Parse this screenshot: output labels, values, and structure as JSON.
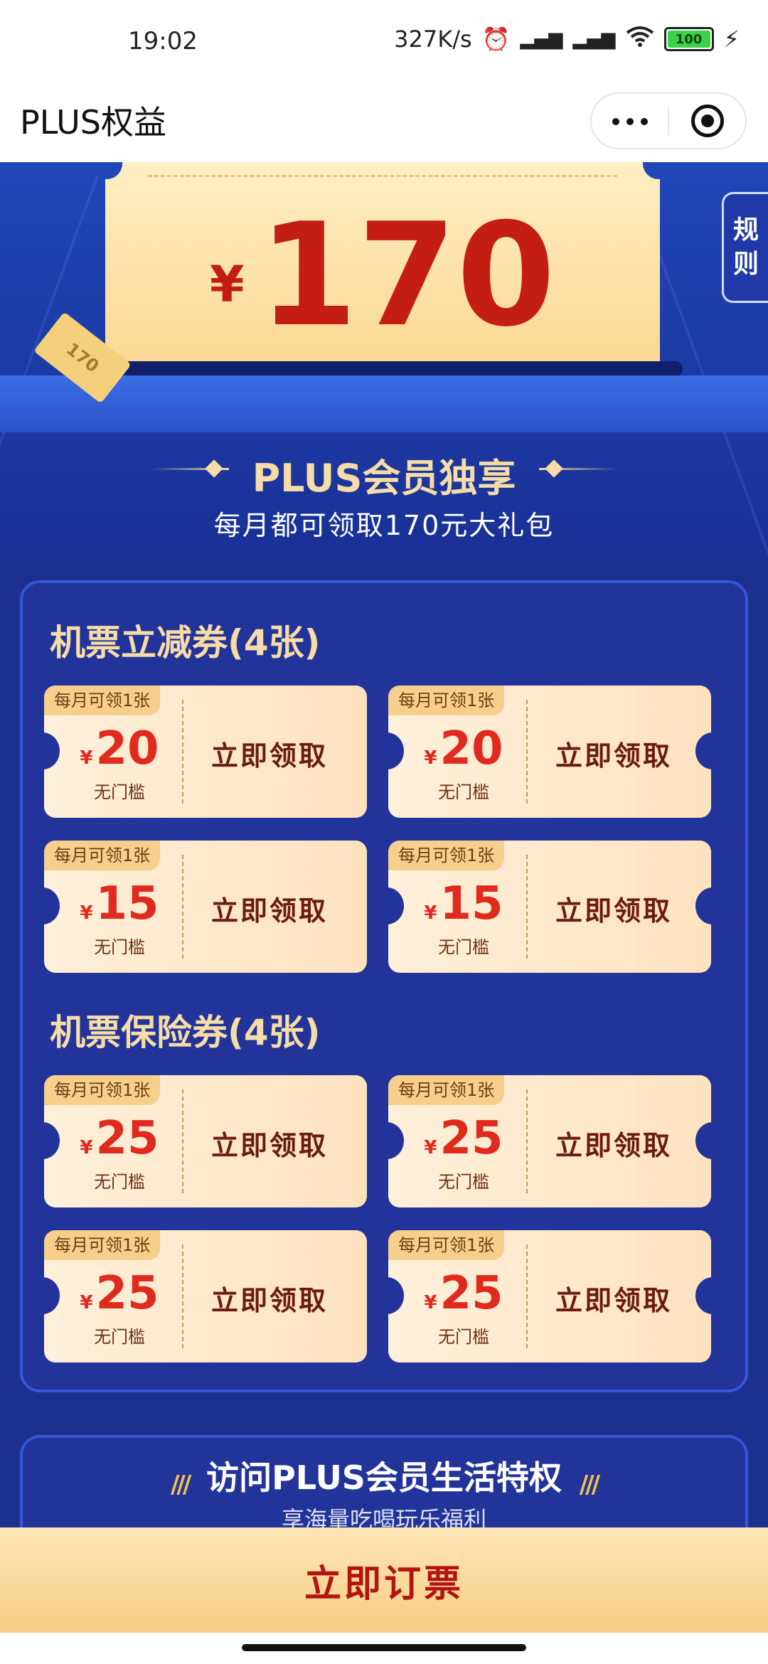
{
  "status_bar": {
    "time": "19:02",
    "speed": "327K/s",
    "battery": "100",
    "icons": [
      "alarm-icon",
      "signal-hd-icon",
      "signal-hd-icon",
      "wifi-icon",
      "battery-icon",
      "charging-icon"
    ]
  },
  "header": {
    "title": "PLUS权益",
    "more_icon": "more-dots-icon",
    "close_icon": "target-circle-icon"
  },
  "hero": {
    "currency": "¥",
    "amount": "170",
    "stub_text": "170",
    "rules_label": "规\n则",
    "plus_title": "PLUS会员独享",
    "plus_subtitle": "每月都可领取170元大礼包"
  },
  "sections": [
    {
      "title": "机票立减券(4张)",
      "coupons": [
        {
          "tag": "每月可领1张",
          "currency": "¥",
          "value": "20",
          "condition": "无门槛",
          "action": "立即领取"
        },
        {
          "tag": "每月可领1张",
          "currency": "¥",
          "value": "20",
          "condition": "无门槛",
          "action": "立即领取"
        },
        {
          "tag": "每月可领1张",
          "currency": "¥",
          "value": "15",
          "condition": "无门槛",
          "action": "立即领取"
        },
        {
          "tag": "每月可领1张",
          "currency": "¥",
          "value": "15",
          "condition": "无门槛",
          "action": "立即领取"
        }
      ]
    },
    {
      "title": "机票保险券(4张)",
      "coupons": [
        {
          "tag": "每月可领1张",
          "currency": "¥",
          "value": "25",
          "condition": "无门槛",
          "action": "立即领取"
        },
        {
          "tag": "每月可领1张",
          "currency": "¥",
          "value": "25",
          "condition": "无门槛",
          "action": "立即领取"
        },
        {
          "tag": "每月可领1张",
          "currency": "¥",
          "value": "25",
          "condition": "无门槛",
          "action": "立即领取"
        },
        {
          "tag": "每月可领1张",
          "currency": "¥",
          "value": "25",
          "condition": "无门槛",
          "action": "立即领取"
        }
      ]
    }
  ],
  "life": {
    "title": "访问PLUS会员生活特权",
    "subtitle": "享海量吃喝玩乐福利"
  },
  "bottom_button": "立即订票",
  "colors": {
    "background": "#1d2f8f",
    "gold": "#f6dca6",
    "price_red": "#e02a1e",
    "button_gold": "#f8cd83"
  }
}
